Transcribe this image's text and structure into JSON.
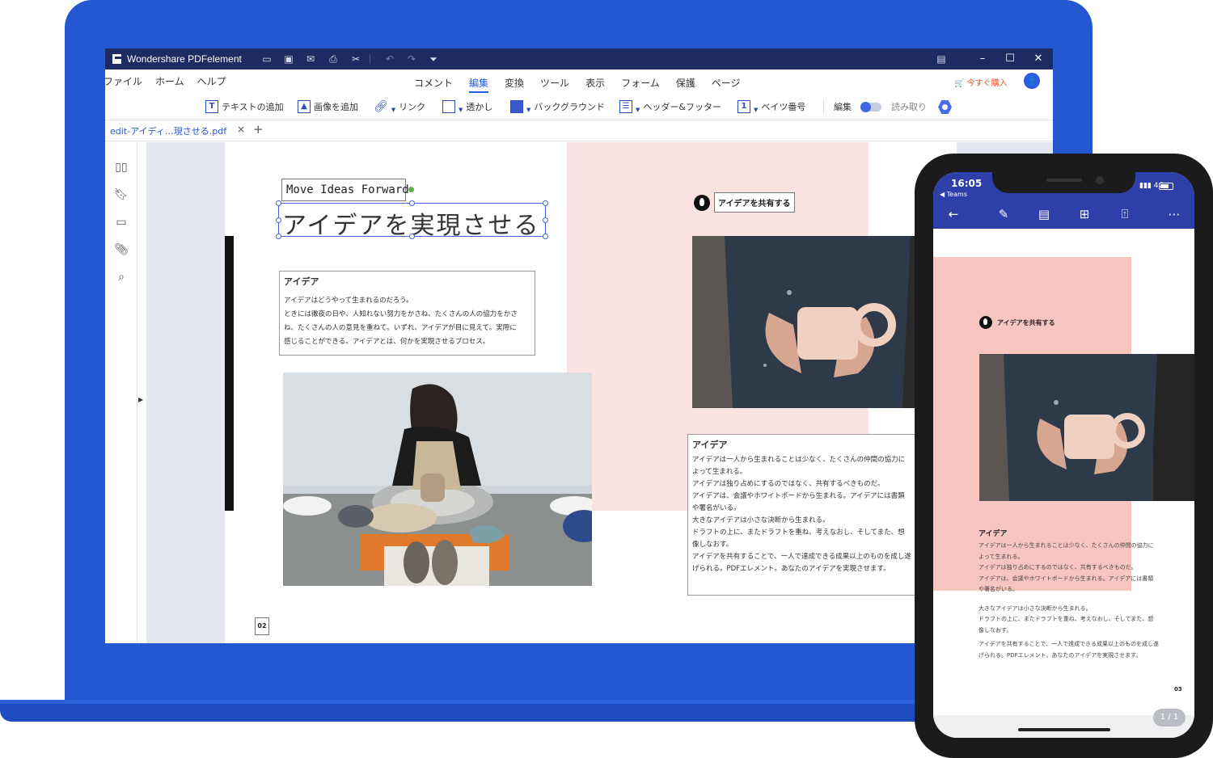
{
  "app": {
    "title": "Wondershare PDFelement",
    "buy_label": "今すぐ購入"
  },
  "menu": {
    "left": [
      "ファイル",
      "ホーム",
      "ヘルプ"
    ],
    "center": [
      "コメント",
      "編集",
      "変換",
      "ツール",
      "表示",
      "フォーム",
      "保護",
      "ページ"
    ],
    "active": "編集"
  },
  "toolbar": {
    "add_text": "テキストの追加",
    "add_image": "画像を追加",
    "link": "リンク",
    "watermark": "透かし",
    "background": "バックグラウンド",
    "header_footer": "ヘッダー&フッター",
    "bates": "ベイツ番号",
    "edit_mode": "編集",
    "read_mode": "読み取り"
  },
  "tab": {
    "name": "edit-アイディ…現させる.pdf",
    "close": "×",
    "add": "+"
  },
  "document": {
    "subtitle": "Move Ideas Forward",
    "headline": "アイデアを実現させる",
    "left_box": {
      "heading": "アイデア",
      "lines": [
        "アイデアはどうやって生まれるのだろう。",
        "ときには徹夜の日や、人知れない努力をかさね、たくさんの人の協力をかさ",
        "ね、たくさんの人の意見を重ねて。いずれ、アイデアが目に見えて。実際に",
        "感じることができる。アイデアとは、何かを実現させるプロセス。"
      ]
    },
    "share_label": "アイデアを共有する",
    "right_box": {
      "heading": "アイデア",
      "lines": [
        "アイデアは一人から生まれることは少なく、たくさんの仲間の協力に",
        "よって生まれる。",
        "",
        "アイデアは独り占めにするのではなく、共有するべきものだ。",
        "アイデアは、会議やホワイトボードから生まれる。アイデアには書類",
        "や署名がいる。",
        "",
        "大きなアイデアは小さな決断から生まれる。",
        "ドラフトの上に、またドラフトを重ね、考えなおし、そしてまた、想",
        "像しなおす。",
        "",
        "アイデアを共有することで、一人で達成できる成果以上のものを成し遂",
        "げられる。PDFエレメント。あなたのアイデアを実現させます。"
      ]
    },
    "page_number": "02"
  },
  "phone": {
    "time": "16:05",
    "back_app": "◀ Teams",
    "network": "4G",
    "share_label": "アイデアを共有する",
    "heading": "アイデア",
    "lines": [
      "アイデアは一人から生まれることは少なく、たくさんの仲間の協力に",
      "よって生まれる。",
      "アイデアは独り占めにするのではなく、共有するべきものだ。",
      "アイデアは、会議やホワイトボードから生まれる。アイデアには書類",
      "や署名がいる。",
      "大きなアイデアは小さな決断から生まれる。",
      "ドラフトの上に、またドラフトを重ね、考えなおし、そしてまた、想",
      "像しなおす。",
      "アイデアを共有することで、一人で達成できる成果以上のものを成し遂",
      "げられる。PDFエレメント。あなたのアイデアを実現させます。"
    ],
    "page_number": "03",
    "page_indicator": "1 / 1"
  },
  "colors": {
    "laptop": "#2457d0",
    "titlebar": "#1c2b62",
    "accent": "#2459e0",
    "pink": "#fbe3e2",
    "phone_pink": "#f8c6c0",
    "phone_bar": "#2f3fa9"
  }
}
